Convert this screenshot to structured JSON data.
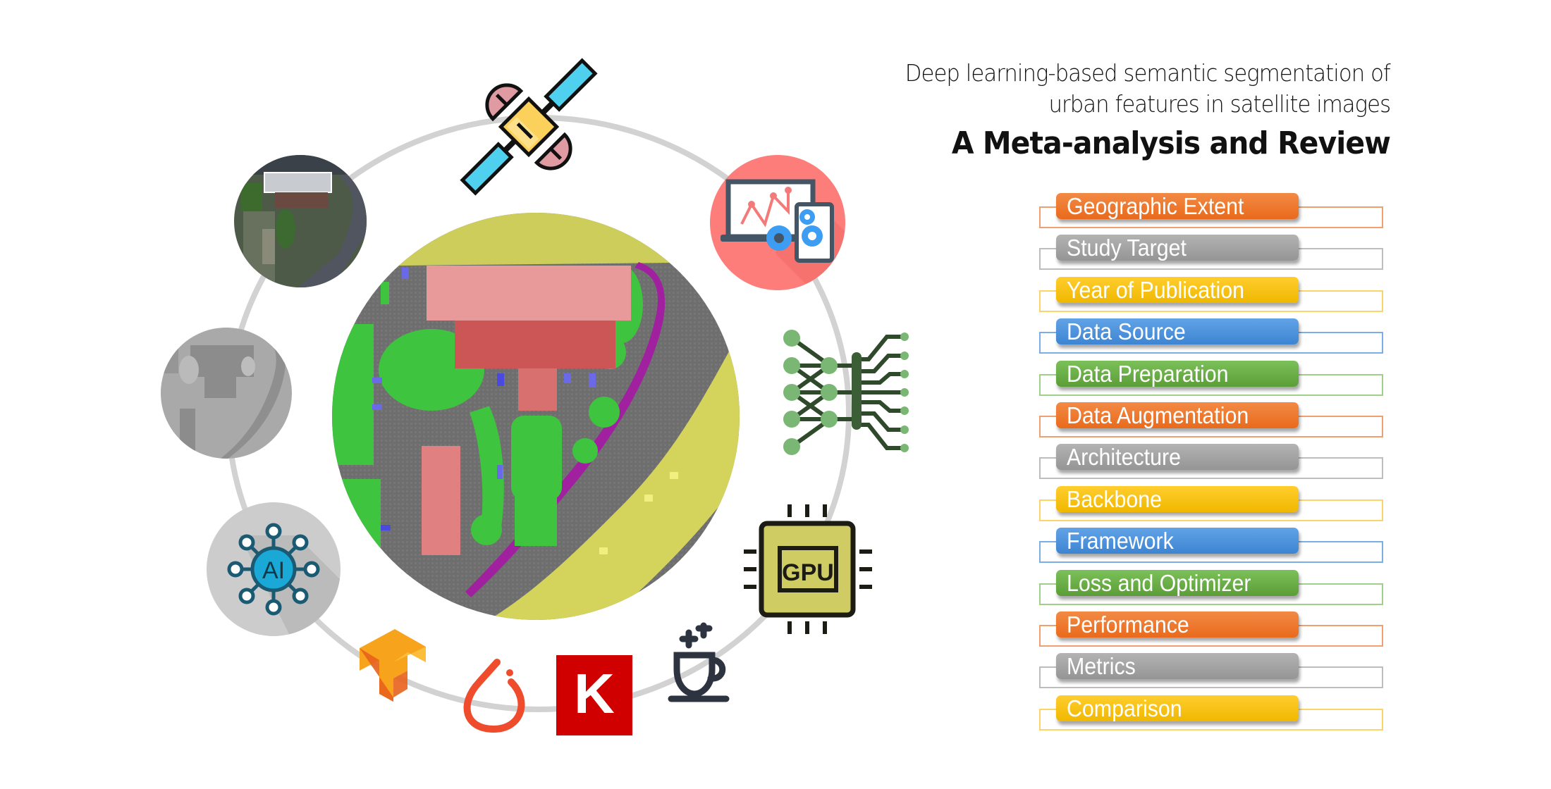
{
  "title": {
    "line1": "Deep learning-based semantic segmentation of",
    "line2": "urban features in satellite images",
    "line3": "A Meta-analysis and Review"
  },
  "colors": {
    "orange": "#ee7a2f",
    "gray": "#a6a6a6",
    "yellow": "#fcc21a",
    "blue": "#4a90d9",
    "green": "#6ab04c",
    "ring": "#d2d2d2",
    "seg_building": "#e06666",
    "seg_vegetation": "#3ec43e",
    "seg_road": "#d6d65a",
    "seg_sidewalk": "#a020a0",
    "seg_car": "#4a4ae0"
  },
  "topics": [
    {
      "label": "Geographic Extent",
      "color": "orange"
    },
    {
      "label": "Study Target",
      "color": "gray"
    },
    {
      "label": "Year of Publication",
      "color": "yellow"
    },
    {
      "label": "Data Source",
      "color": "blue"
    },
    {
      "label": "Data Preparation",
      "color": "green"
    },
    {
      "label": "Data Augmentation",
      "color": "orange"
    },
    {
      "label": "Architecture",
      "color": "gray"
    },
    {
      "label": "Backbone",
      "color": "yellow"
    },
    {
      "label": "Framework",
      "color": "blue"
    },
    {
      "label": "Loss and Optimizer",
      "color": "green"
    },
    {
      "label": "Performance",
      "color": "orange"
    },
    {
      "label": "Metrics",
      "color": "gray"
    },
    {
      "label": "Comparison",
      "color": "yellow"
    }
  ],
  "icons": {
    "satellite": "satellite-icon",
    "dashboard": "analytics-dashboard-icon",
    "neural_network": "neural-network-icon",
    "gpu": "gpu-chip-icon",
    "gpu_label": "GPU",
    "java": "java-cup-icon",
    "keras": "keras-logo",
    "keras_label": "K",
    "pytorch": "pytorch-logo",
    "tensorflow": "tensorflow-logo",
    "ai": "ai-network-icon",
    "ai_label": "AI",
    "mask": "segmentation-mask-image",
    "aerial": "aerial-photo-image",
    "center": "segmented-aerial-image"
  }
}
